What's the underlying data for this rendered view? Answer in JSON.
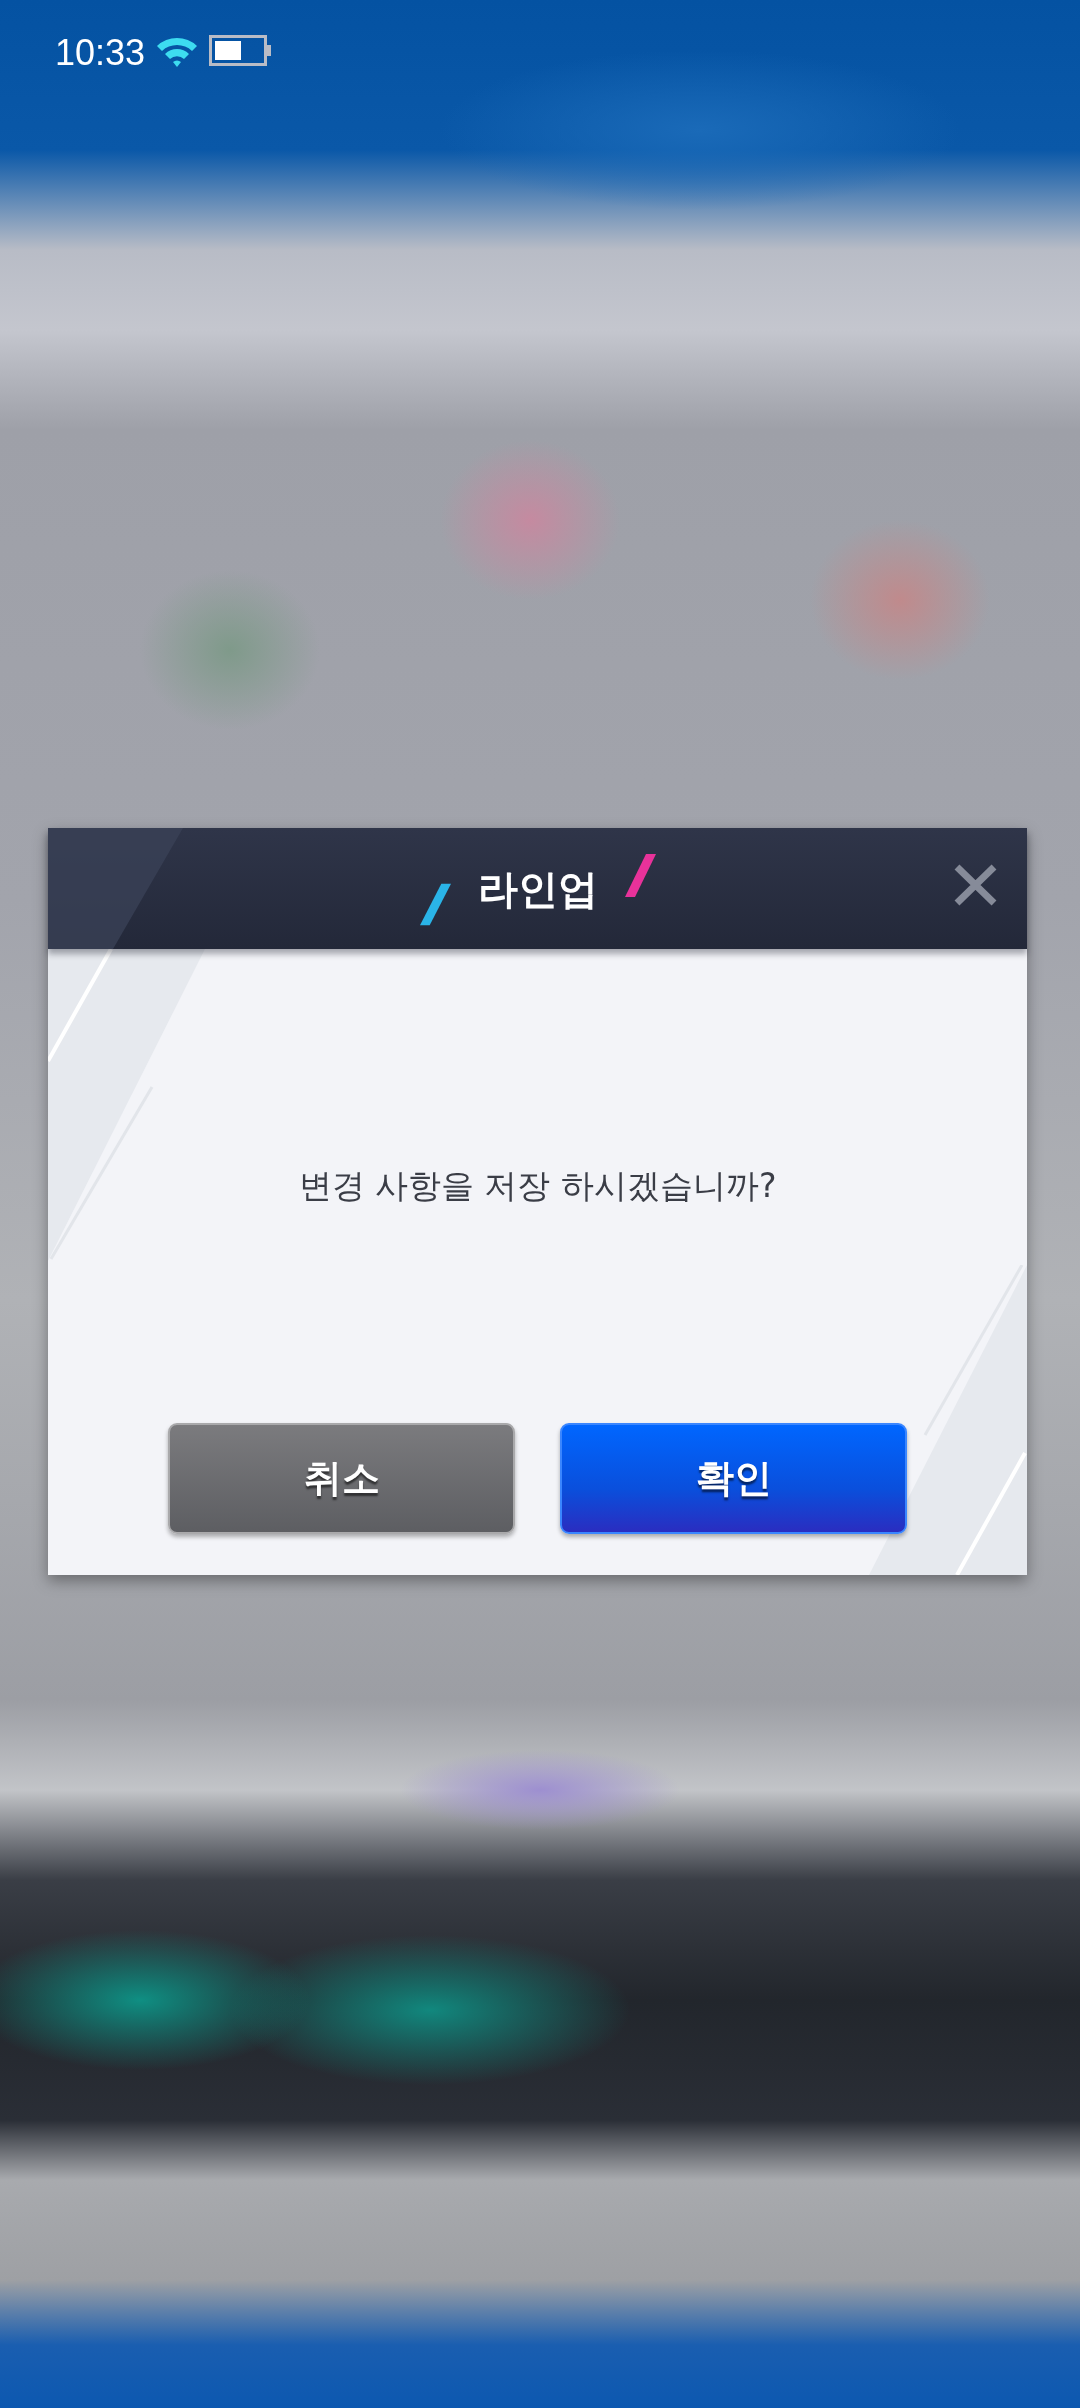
{
  "status_bar": {
    "time": "10:33"
  },
  "dialog": {
    "title": "라인업",
    "message": "변경 사항을 저장 하시겠습니까?",
    "buttons": [
      {
        "label": "취소",
        "kind": "cancel"
      },
      {
        "label": "확인",
        "kind": "confirm"
      }
    ]
  }
}
